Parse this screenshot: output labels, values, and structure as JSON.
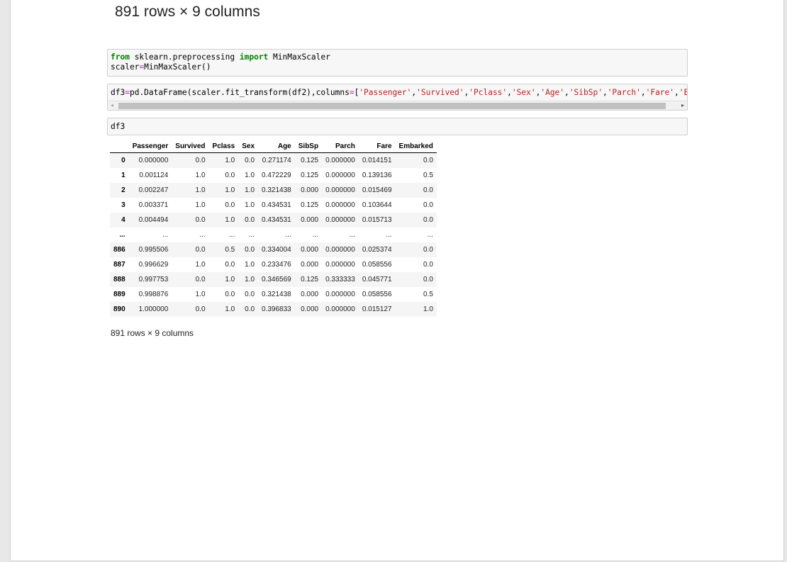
{
  "top_heading": "891 rows × 9 columns",
  "cells": {
    "cell1": {
      "kw_from": "from",
      "module": " sklearn.preprocessing ",
      "kw_import": "import",
      "name": " MinMaxScaler",
      "line2_var": "scaler",
      "line2_op": "=",
      "line2_rest": "MinMaxScaler()"
    },
    "cell2": {
      "var": "df3",
      "op1": "=",
      "call": "pd.DataFrame(scaler.fit_transform(df2),columns",
      "op2": "=",
      "bracket": "[",
      "c1": "'Passenger'",
      "c2": "'Survived'",
      "c3": "'Pclass'",
      "c4": "'Sex'",
      "c5": "'Age'",
      "c6": "'SibSp'",
      "c7": "'Parch'",
      "c8": "'Fare'",
      "c9": "'Embarked'",
      "comma": ","
    },
    "cell3": {
      "code": "df3"
    }
  },
  "table": {
    "columns": [
      "",
      "Passenger",
      "Survived",
      "Pclass",
      "Sex",
      "Age",
      "SibSp",
      "Parch",
      "Fare",
      "Embarked"
    ],
    "rows": [
      [
        "0",
        "0.000000",
        "0.0",
        "1.0",
        "0.0",
        "0.271174",
        "0.125",
        "0.000000",
        "0.014151",
        "0.0"
      ],
      [
        "1",
        "0.001124",
        "1.0",
        "0.0",
        "1.0",
        "0.472229",
        "0.125",
        "0.000000",
        "0.139136",
        "0.5"
      ],
      [
        "2",
        "0.002247",
        "1.0",
        "1.0",
        "1.0",
        "0.321438",
        "0.000",
        "0.000000",
        "0.015469",
        "0.0"
      ],
      [
        "3",
        "0.003371",
        "1.0",
        "0.0",
        "1.0",
        "0.434531",
        "0.125",
        "0.000000",
        "0.103644",
        "0.0"
      ],
      [
        "4",
        "0.004494",
        "0.0",
        "1.0",
        "0.0",
        "0.434531",
        "0.000",
        "0.000000",
        "0.015713",
        "0.0"
      ],
      [
        "...",
        "...",
        "...",
        "...",
        "...",
        "...",
        "...",
        "...",
        "...",
        "..."
      ],
      [
        "886",
        "0.995506",
        "0.0",
        "0.5",
        "0.0",
        "0.334004",
        "0.000",
        "0.000000",
        "0.025374",
        "0.0"
      ],
      [
        "887",
        "0.996629",
        "1.0",
        "0.0",
        "1.0",
        "0.233476",
        "0.000",
        "0.000000",
        "0.058556",
        "0.0"
      ],
      [
        "888",
        "0.997753",
        "0.0",
        "1.0",
        "1.0",
        "0.346569",
        "0.125",
        "0.333333",
        "0.045771",
        "0.0"
      ],
      [
        "889",
        "0.998876",
        "1.0",
        "0.0",
        "0.0",
        "0.321438",
        "0.000",
        "0.000000",
        "0.058556",
        "0.5"
      ],
      [
        "890",
        "1.000000",
        "0.0",
        "1.0",
        "0.0",
        "0.396833",
        "0.000",
        "0.000000",
        "0.015127",
        "1.0"
      ]
    ]
  },
  "rows_note": "891 rows × 9 columns",
  "scrollbar": {
    "left_arrow": "◂",
    "right_arrow": "▸"
  },
  "colors": {
    "keyword": "#008000",
    "operator": "#aa22ff",
    "string": "#ba2121",
    "cell_background": "#f7f7f7"
  }
}
